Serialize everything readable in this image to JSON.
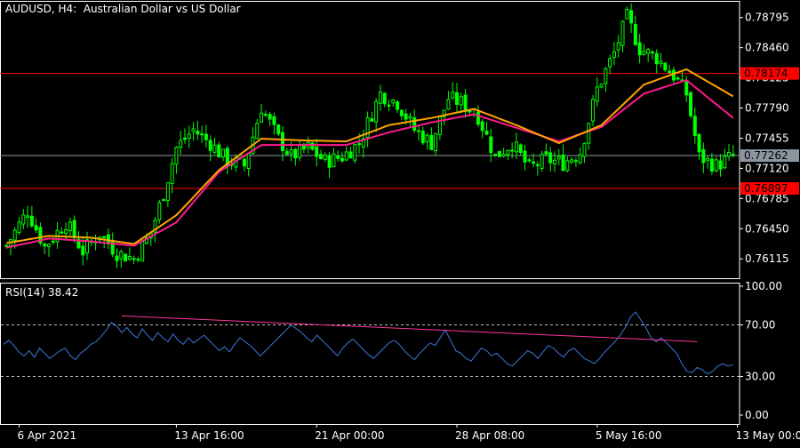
{
  "window": {
    "symbol_line": "AUDUSD, H4:  Australian Dollar vs US Dollar",
    "indicator_line_label": "RSI(14)",
    "indicator_line_value": "38.42"
  },
  "colors": {
    "background": "#000000",
    "frame": "#ffffff",
    "bull_candle": "#00ff00",
    "bear_candle": "#00ff00",
    "ma_fast": "#ffa500",
    "ma_slow": "#ff1a8c",
    "hline_resistance": "#ff0000",
    "hline_support": "#ff0000",
    "hline_current": "#8c96a0",
    "rsi_line": "#3c78d8",
    "rsi_trendline": "#ff3399",
    "rsi_level": "#c0c0c0"
  },
  "chart_data": [
    {
      "type": "candlestick",
      "symbol": "AUDUSD",
      "timeframe": "H4",
      "title": "AUDUSD, H4:  Australian Dollar vs US Dollar",
      "ylim": [
        0.759,
        0.7897
      ],
      "y_ticks": [
        "0.78795",
        "0.78460",
        "0.78125",
        "0.77790",
        "0.77455",
        "0.77120",
        "0.76785",
        "0.76450",
        "0.76115"
      ],
      "x_ticks": [
        {
          "label": "6 Apr 2021",
          "index": 3
        },
        {
          "label": "13 Apr 16:00",
          "index": 40
        },
        {
          "label": "21 Apr 00:00",
          "index": 73
        },
        {
          "label": "28 Apr 08:00",
          "index": 106
        },
        {
          "label": "5 May 16:00",
          "index": 139
        },
        {
          "label": "13 May 00:00",
          "index": 172
        }
      ],
      "horizontal_lines": [
        {
          "name": "resistance",
          "price": 0.78174,
          "label": "0.78174",
          "style": "solid-red"
        },
        {
          "name": "current",
          "price": 0.77262,
          "label": "0.77262",
          "style": "solid-gray"
        },
        {
          "name": "support",
          "price": 0.76897,
          "label": "0.76897",
          "style": "solid-red"
        }
      ],
      "close_anchors": [
        [
          0,
          0.7626
        ],
        [
          5,
          0.7665
        ],
        [
          9,
          0.7625
        ],
        [
          14,
          0.7652
        ],
        [
          18,
          0.762
        ],
        [
          22,
          0.764
        ],
        [
          26,
          0.7618
        ],
        [
          30,
          0.7612
        ],
        [
          34,
          0.764
        ],
        [
          37,
          0.7685
        ],
        [
          40,
          0.7735
        ],
        [
          44,
          0.7755
        ],
        [
          48,
          0.774
        ],
        [
          52,
          0.772
        ],
        [
          56,
          0.7715
        ],
        [
          60,
          0.778
        ],
        [
          64,
          0.7745
        ],
        [
          67,
          0.7725
        ],
        [
          71,
          0.7735
        ],
        [
          75,
          0.772
        ],
        [
          79,
          0.7725
        ],
        [
          83,
          0.774
        ],
        [
          88,
          0.7795
        ],
        [
          92,
          0.7785
        ],
        [
          96,
          0.7755
        ],
        [
          100,
          0.774
        ],
        [
          104,
          0.779
        ],
        [
          107,
          0.7785
        ],
        [
          111,
          0.777
        ],
        [
          115,
          0.7725
        ],
        [
          119,
          0.774
        ],
        [
          123,
          0.7712
        ],
        [
          127,
          0.7722
        ],
        [
          131,
          0.7718
        ],
        [
          135,
          0.773
        ],
        [
          139,
          0.78
        ],
        [
          143,
          0.784
        ],
        [
          146,
          0.788
        ],
        [
          149,
          0.7845
        ],
        [
          153,
          0.7835
        ],
        [
          157,
          0.7815
        ],
        [
          160,
          0.7795
        ],
        [
          163,
          0.7725
        ],
        [
          167,
          0.7715
        ],
        [
          171,
          0.7726
        ]
      ],
      "candle_count": 172,
      "ma_fast_anchors": [
        [
          0,
          0.7629
        ],
        [
          10,
          0.7637
        ],
        [
          20,
          0.7635
        ],
        [
          30,
          0.7628
        ],
        [
          40,
          0.766
        ],
        [
          50,
          0.771
        ],
        [
          60,
          0.7745
        ],
        [
          70,
          0.7743
        ],
        [
          80,
          0.7742
        ],
        [
          90,
          0.776
        ],
        [
          100,
          0.7768
        ],
        [
          110,
          0.7778
        ],
        [
          120,
          0.776
        ],
        [
          130,
          0.774
        ],
        [
          140,
          0.776
        ],
        [
          150,
          0.7805
        ],
        [
          160,
          0.7822
        ],
        [
          171,
          0.7792
        ]
      ],
      "ma_slow_anchors": [
        [
          0,
          0.7624
        ],
        [
          10,
          0.7634
        ],
        [
          20,
          0.7631
        ],
        [
          30,
          0.7626
        ],
        [
          40,
          0.7652
        ],
        [
          50,
          0.7708
        ],
        [
          60,
          0.7738
        ],
        [
          70,
          0.7738
        ],
        [
          80,
          0.7738
        ],
        [
          90,
          0.7752
        ],
        [
          100,
          0.7763
        ],
        [
          110,
          0.7772
        ],
        [
          120,
          0.7757
        ],
        [
          130,
          0.7742
        ],
        [
          140,
          0.7758
        ],
        [
          150,
          0.7795
        ],
        [
          160,
          0.781
        ],
        [
          171,
          0.7768
        ]
      ]
    },
    {
      "type": "line",
      "title": "RSI(14) 38.42",
      "ylim": [
        0,
        100
      ],
      "y_ticks": [
        "100.00",
        "70.00",
        "30.00",
        "0.00"
      ],
      "levels": [
        70,
        30
      ],
      "values": [
        55,
        58,
        54,
        49,
        46,
        50,
        45,
        52,
        48,
        44,
        47,
        50,
        52,
        46,
        43,
        48,
        51,
        55,
        57,
        61,
        66,
        72,
        69,
        64,
        68,
        63,
        60,
        67,
        62,
        58,
        64,
        60,
        57,
        63,
        58,
        55,
        60,
        56,
        59,
        62,
        58,
        54,
        50,
        53,
        49,
        55,
        60,
        57,
        54,
        50,
        46,
        50,
        54,
        58,
        62,
        66,
        70,
        67,
        64,
        60,
        57,
        62,
        58,
        54,
        50,
        46,
        52,
        56,
        59,
        55,
        51,
        47,
        44,
        48,
        52,
        56,
        58,
        55,
        50,
        46,
        43,
        48,
        52,
        56,
        54,
        60,
        66,
        58,
        50,
        48,
        44,
        42,
        47,
        52,
        50,
        46,
        48,
        44,
        40,
        38,
        42,
        46,
        50,
        48,
        44,
        49,
        54,
        52,
        48,
        45,
        50,
        52,
        48,
        44,
        42,
        40,
        44,
        49,
        53,
        57,
        62,
        68,
        76,
        80,
        74,
        68,
        60,
        57,
        60,
        56,
        52,
        48,
        40,
        34,
        33,
        37,
        35,
        32,
        34,
        38,
        40,
        38,
        39
      ],
      "trendline": [
        [
          23,
          77
        ],
        [
          135,
          57
        ]
      ]
    }
  ]
}
